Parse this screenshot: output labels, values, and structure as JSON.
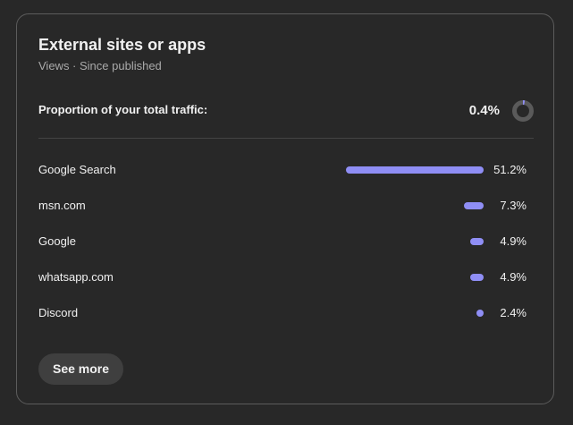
{
  "card": {
    "title": "External sites or apps",
    "subtitle": "Views · Since published",
    "proportion_label": "Proportion of your total traffic:",
    "proportion_value": "0.4%",
    "proportion_fraction": 0.004,
    "see_more_label": "See more"
  },
  "colors": {
    "background": "#282828",
    "bar": "#8f8ef5",
    "donut_track": "#5a5a5a",
    "donut_fill": "#8f8ef5",
    "button_bg": "#3f3f3f"
  },
  "sources": [
    {
      "label": "Google Search",
      "percent": "51.2%",
      "value": 51.2
    },
    {
      "label": "msn.com",
      "percent": "7.3%",
      "value": 7.3
    },
    {
      "label": "Google",
      "percent": "4.9%",
      "value": 4.9
    },
    {
      "label": "whatsapp.com",
      "percent": "4.9%",
      "value": 4.9
    },
    {
      "label": "Discord",
      "percent": "2.4%",
      "value": 2.4
    }
  ]
}
